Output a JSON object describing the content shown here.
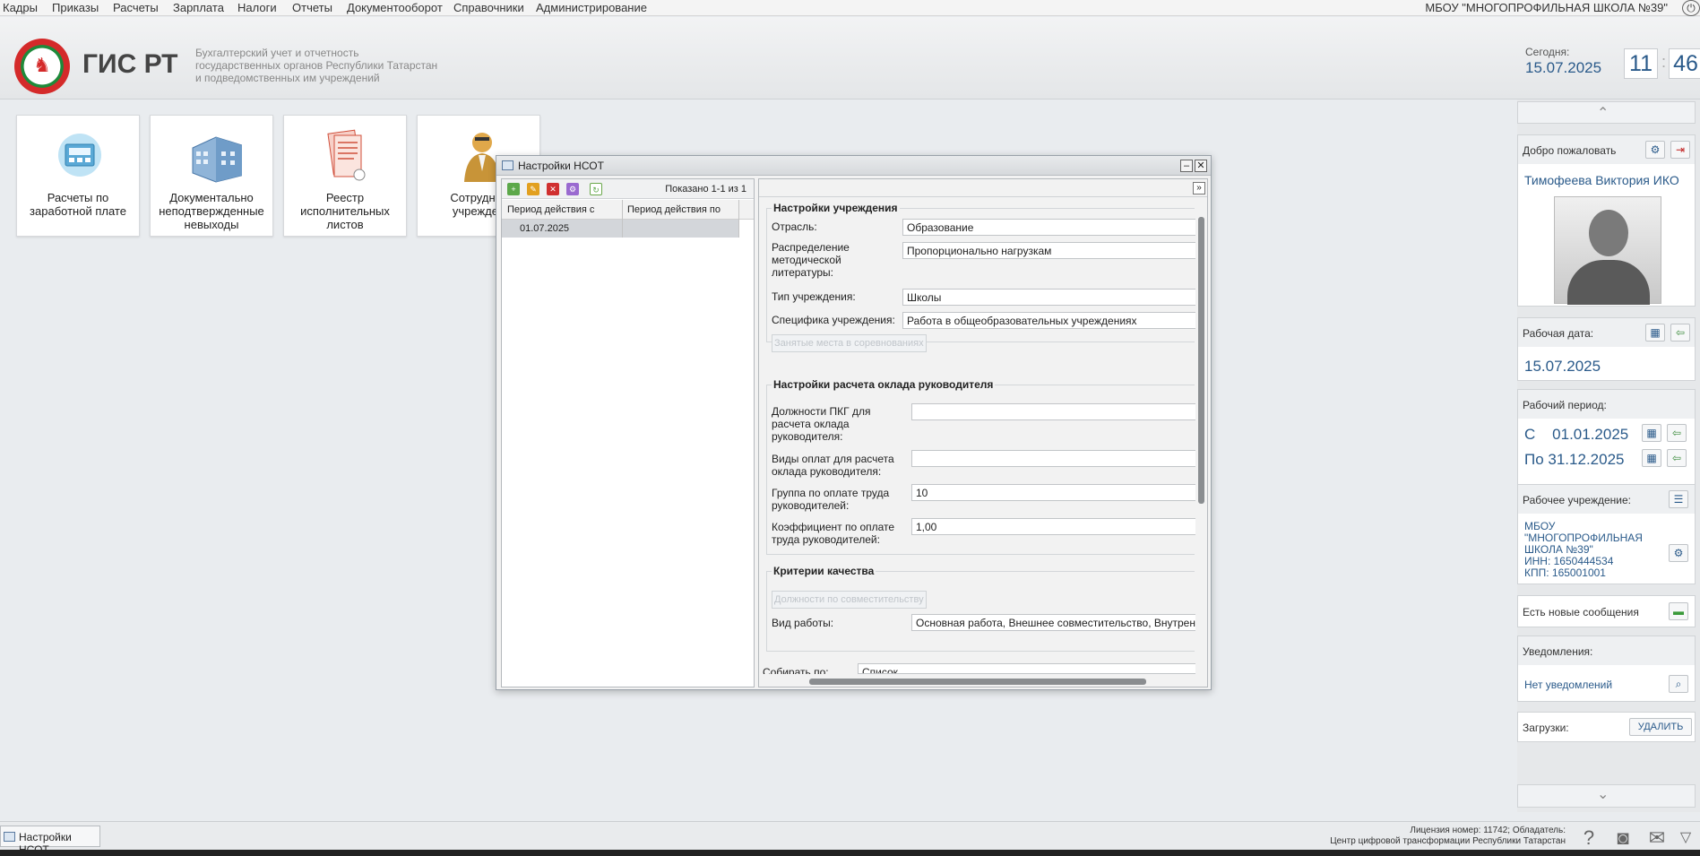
{
  "menu": {
    "items": [
      "Кадры",
      "Приказы",
      "Расчеты",
      "Зарплата",
      "Налоги",
      "Отчеты",
      "Документооборот",
      "Справочники",
      "Администрирование"
    ],
    "org_name": "МБОУ \"МНОГОПРОФИЛЬНАЯ ШКОЛА №39\""
  },
  "header": {
    "title": "ГИС РТ",
    "subtitle_1": "Бухгалтерский учет и отчетность",
    "subtitle_2": "государственных органов Республики Татарстан",
    "subtitle_3": "и подведомственных им учреждений",
    "today_label": "Сегодня:",
    "today_date": "15.07.2025",
    "clock_hours": "11",
    "clock_minutes": "46"
  },
  "tiles": [
    {
      "line1": "Расчеты по",
      "line2": "заработной плате",
      "line3": ""
    },
    {
      "line1": "Документально",
      "line2": "неподтвержденные",
      "line3": "невыходы"
    },
    {
      "line1": "Реестр",
      "line2": "исполнительных",
      "line3": "листов"
    },
    {
      "line1": "Сотрудник",
      "line2": "учрежден",
      "line3": ""
    }
  ],
  "dialog": {
    "title": "Настройки НСОТ",
    "shown_count": "Показано 1-1 из 1",
    "grid": {
      "columns": [
        "Период действия с",
        "Период действия по"
      ],
      "rows": [
        [
          "01.07.2025",
          ""
        ]
      ]
    },
    "section_institution": {
      "title": "Настройки учреждения",
      "industry_label": "Отрасль:",
      "industry_value": "Образование",
      "distribution_label_1": "Распределение",
      "distribution_label_2": "методической",
      "distribution_label_3": "литературы:",
      "distribution_value": "Пропорционально нагрузкам",
      "type_label": "Тип учреждения:",
      "type_value": "Школы",
      "specifics_label": "Специфика учреждения:",
      "specifics_value": "Работа в общеобразовательных учреждениях",
      "competitions_button": "Занятые места в соревнованиях"
    },
    "section_head_salary": {
      "title": "Настройки расчета оклада руководителя",
      "pkg_label_1": "Должности ПКГ для",
      "pkg_label_2": "расчета оклада",
      "pkg_label_3": "руководителя:",
      "pkg_value": "",
      "pay_types_label_1": "Виды оплат для расчета",
      "pay_types_label_2": "оклада руководителя:",
      "pay_types_value": "",
      "group_label_1": "Группа по оплате труда",
      "group_label_2": "руководителей:",
      "group_value": "10",
      "coef_label_1": "Коэффициент по оплате",
      "coef_label_2": "труда руководителей:",
      "coef_value": "1,00"
    },
    "section_quality": {
      "title": "Критерии качества",
      "positions_button": "Должности по совместительству",
      "work_type_label": "Вид работы:",
      "work_type_value": "Основная работа, Внешнее совместительство, Внутренн"
    },
    "collect_label": "Собирать по:",
    "collect_value": "Список"
  },
  "sidebar": {
    "welcome_title": "Добро пожаловать",
    "user_name": "Тимофеева Виктория ИКО",
    "work_date_title": "Рабочая дата:",
    "work_date_value": "15.07.2025",
    "work_period_title": "Рабочий период:",
    "period_from": "С    01.01.2025",
    "period_to": "По 31.12.2025",
    "institution_title": "Рабочее учреждение:",
    "institution_line1": "МБОУ",
    "institution_line2": "\"МНОГОПРОФИЛЬНАЯ",
    "institution_line3": "ШКОЛА №39\"",
    "institution_inn": "ИНН: 1650444534",
    "institution_kpp": "КПП: 165001001",
    "messages_title": "Есть новые сообщения",
    "notifications_title": "Уведомления:",
    "notifications_value": "Нет уведомлений",
    "downloads_title": "Загрузки:",
    "delete_button": "УДАЛИТЬ"
  },
  "taskbar": {
    "task_label": "Настройки НСОТ",
    "license_line1": "Лицензия номер: 11742; Обладатель:",
    "license_line2": "Центр цифровой трансформации Республики Татарстан"
  }
}
